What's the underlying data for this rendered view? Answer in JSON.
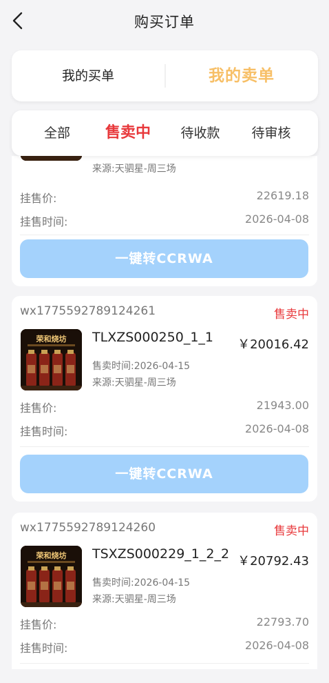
{
  "header": {
    "title": "购买订单",
    "back_icon": "chevron-left-icon"
  },
  "switcher": {
    "buy_label": "我的买单",
    "sell_label": "我的卖单",
    "active_color": "#f7bf66"
  },
  "tabs": [
    {
      "label": "全部"
    },
    {
      "label": "售卖中"
    },
    {
      "label": "待收款"
    },
    {
      "label": "待审核"
    }
  ],
  "active_tab_color": "#e8383b",
  "orders": [
    {
      "source": "来源:天驷星-周三场",
      "list_price_label": "挂售价:",
      "list_price": "22619.18",
      "list_time_label": "挂售时间:",
      "list_time": "2026-04-08",
      "button_label": "一键转CCRWA"
    },
    {
      "order_id": "wx1775592789124261",
      "status": "售卖中",
      "product_name": "TLXZS000250_1_1",
      "price": "￥20016.42",
      "sale_time": "售卖时间:2026-04-15",
      "source": "来源:天驷星-周三场",
      "list_price_label": "挂售价:",
      "list_price": "21943.00",
      "list_time_label": "挂售时间:",
      "list_time": "2026-04-08",
      "button_label": "一键转CCRWA",
      "thumb_brand": "荣和烧坊"
    },
    {
      "order_id": "wx1775592789124260",
      "status": "售卖中",
      "product_name": "TSXZS000229_1_2_2",
      "price": "￥20792.43",
      "sale_time": "售卖时间:2026-04-15",
      "source": "来源:天驷星-周三场",
      "list_price_label": "挂售价:",
      "list_price": "22793.70",
      "list_time_label": "挂售时间:",
      "list_time": "2026-04-08",
      "thumb_brand": "荣和烧坊"
    }
  ]
}
